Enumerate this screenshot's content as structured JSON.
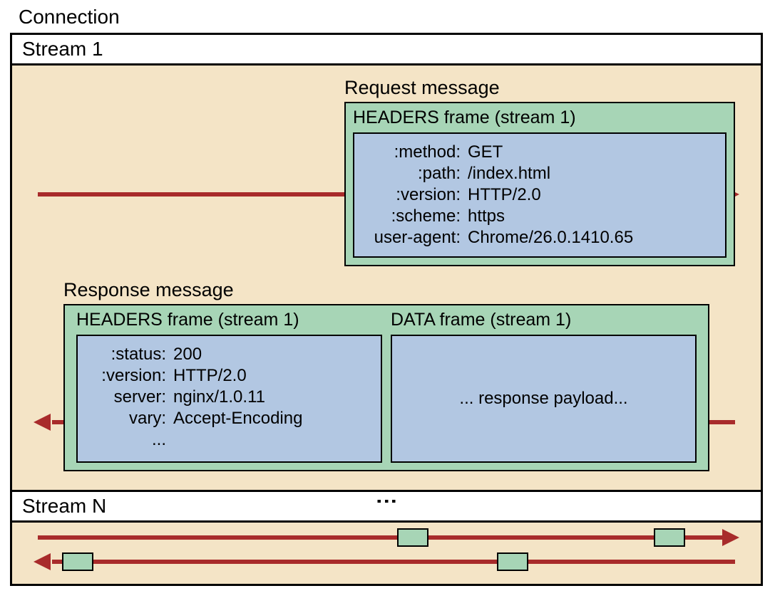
{
  "title": "Connection",
  "stream1": {
    "label": "Stream 1",
    "request": {
      "label": "Request message",
      "frame_title": "HEADERS frame (stream 1)",
      "headers": [
        {
          "k": ":method:",
          "v": "GET"
        },
        {
          "k": ":path:",
          "v": "/index.html"
        },
        {
          "k": ":version:",
          "v": "HTTP/2.0"
        },
        {
          "k": ":scheme:",
          "v": "https"
        },
        {
          "k": "user-agent:",
          "v": "Chrome/26.0.1410.65"
        }
      ]
    },
    "response": {
      "label": "Response message",
      "headers_title": "HEADERS frame (stream 1)",
      "data_title": "DATA frame (stream 1)",
      "headers": [
        {
          "k": ":status:",
          "v": "200"
        },
        {
          "k": ":version:",
          "v": "HTTP/2.0"
        },
        {
          "k": "server:",
          "v": "nginx/1.0.11"
        },
        {
          "k": "vary:",
          "v": "Accept-Encoding"
        },
        {
          "k": "...",
          "v": ""
        }
      ],
      "data_body": "... response payload..."
    }
  },
  "streamN": {
    "label": "Stream N"
  }
}
